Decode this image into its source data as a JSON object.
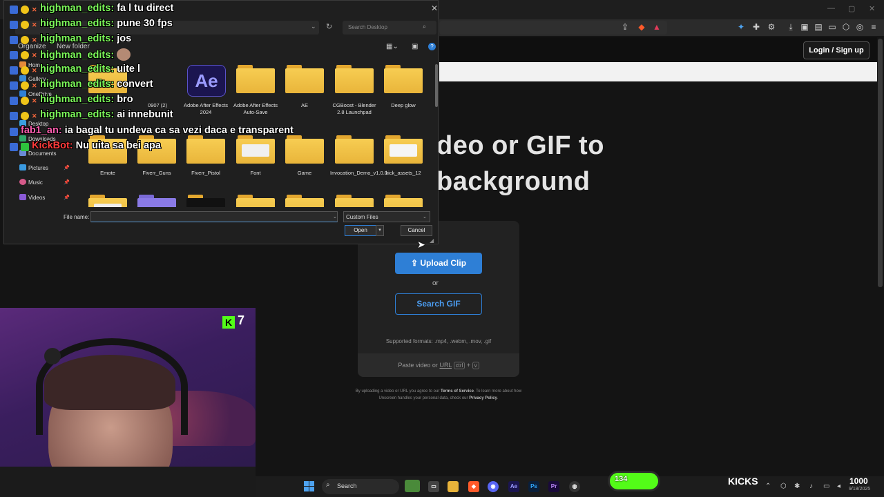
{
  "browser": {
    "login_label": "Login / Sign up",
    "headline_line1": "deo or GIF to",
    "headline_line2": "background",
    "upload_label": "Upload Clip",
    "or_label": "or",
    "search_gif_label": "Search GIF",
    "formats_text": "Supported formats: .mp4, .webm, .mov, .gif",
    "paste_prefix": "Paste video or",
    "paste_url": "URL",
    "paste_key1": "ctrl",
    "paste_plus": "+",
    "paste_key2": "v",
    "legal_1": "By uploading a video or URL you agree to our",
    "legal_tos": "Terms of Service",
    "legal_2": ". To learn more about how Unscreen handles your personal data, check our",
    "legal_privacy": "Privacy Policy",
    "legal_3": "."
  },
  "dialog": {
    "search_placeholder": "Search Desktop",
    "nav": {
      "home": "Home",
      "gallery": "Gallery",
      "onedrive": "OneDrive",
      "desktop": "Desktop",
      "downloads": "Downloads",
      "documents": "Documents",
      "pictures": "Pictures",
      "music": "Music",
      "videos": "Videos",
      "organize": "Organize",
      "new_folder": "New folder"
    },
    "files_row1": [
      {
        "label": "0907 (2)"
      },
      {
        "label": "Adobe After Effects 2024"
      },
      {
        "label": "Adobe After Effects Auto-Save"
      },
      {
        "label": "AE"
      },
      {
        "label": "CGBoost - Blender 2.8 Launchpad"
      },
      {
        "label": "Deep glow"
      }
    ],
    "files_row2": [
      {
        "label": "Emote"
      },
      {
        "label": "Fiverr_Guns"
      },
      {
        "label": "Fiverr_Pistol"
      },
      {
        "label": "Font"
      },
      {
        "label": "Game"
      },
      {
        "label": "Invocation_Demo_v1.0.0"
      },
      {
        "label": "kick_assets_12"
      }
    ],
    "ae_tile_text": "Ae",
    "filename_label": "File name:",
    "filename_value": "",
    "filetype_value": "Custom Files",
    "open_label": "Open",
    "cancel_label": "Cancel"
  },
  "chat": [
    {
      "user": "highman_edits",
      "msg": "fa l tu direct"
    },
    {
      "user": "highman_edits",
      "msg": "pune 30 fps"
    },
    {
      "user": "highman_edits",
      "msg": "jos"
    },
    {
      "user": "highman_edits",
      "msg": ""
    },
    {
      "user": "highman_edits",
      "msg": "uite l"
    },
    {
      "user": "highman_edits",
      "msg": "convert"
    },
    {
      "user": "highman_edits",
      "msg": "bro"
    },
    {
      "user": "highman_edits",
      "msg": "ai innebunit"
    },
    {
      "user": "fab1_an",
      "msg": "ia bagal tu undeva ca sa vezi daca e transparent"
    },
    {
      "user": "KickBot",
      "msg": "Nu uita sa bei apa"
    }
  ],
  "webcam": {
    "kick_count": "7",
    "kick_letter": "K"
  },
  "taskbar": {
    "search_label": "Search",
    "kicks_count": "134",
    "kicks_label": "KICKS",
    "clock": "1000",
    "date": "9/18/2025",
    "app_ae": "Ae",
    "app_ps": "Ps",
    "app_pr": "Pr"
  },
  "colors": {
    "accent_blue": "#2e7fd6",
    "kick_green": "#53fc18",
    "chat_user_green": "#7cf85a",
    "folder_yellow": "#f7cd52"
  }
}
